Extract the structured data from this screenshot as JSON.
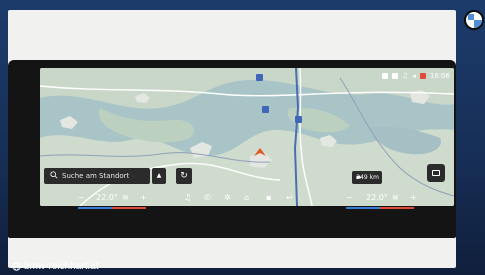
{
  "screen": {
    "status": {
      "time": "16:06"
    },
    "search": {
      "placeholder": "Suche am Standort"
    },
    "range": {
      "value": "249",
      "unit": "km"
    },
    "icons": {
      "search": "magnifier-icon",
      "route": "route-icon",
      "camera": "camera-icon",
      "vehicle": "car-icon",
      "navigation": "navigation-arrow-icon"
    }
  },
  "climate": {
    "left_temp": "22.0°",
    "right_temp": "22.0°",
    "minus": "−",
    "plus": "+",
    "dock_icons": [
      "music-icon",
      "phone-icon",
      "fan-icon",
      "home-icon",
      "apps-icon",
      "back-icon"
    ]
  },
  "footer": {
    "website": "bmw-reichhart.at"
  },
  "colors": {
    "brand_blue": "#1c3b6b",
    "map_water": "#a9c4c7",
    "temp_cold": "#3a7bd5",
    "temp_warm": "#e04a3a",
    "nav_arrow": "#e0591c"
  }
}
